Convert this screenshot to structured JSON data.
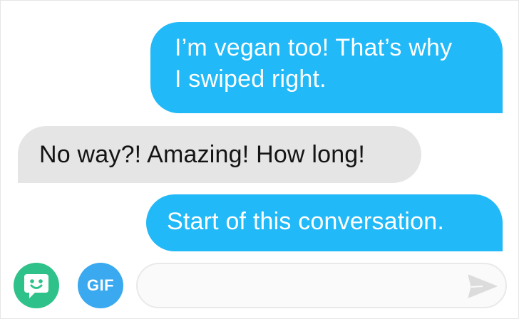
{
  "messages": [
    {
      "direction": "sent",
      "lines": [
        "I’m vegan too! That’s why",
        "I swiped right."
      ]
    },
    {
      "direction": "received",
      "text": "No way?! Amazing! How long!"
    },
    {
      "direction": "sent",
      "text": "Start of this conversation."
    }
  ],
  "composer": {
    "sticker_icon": "smiley-sticker-icon",
    "gif_label": "GIF",
    "input_value": "",
    "input_placeholder": "",
    "send_icon": "send-arrow-icon"
  },
  "colors": {
    "sent_bubble": "#21b9f7",
    "received_bubble": "#e5e5e5",
    "sticker_button": "#2ec28a",
    "gif_button": "#3aa9ef",
    "send_icon": "#dcdcdc"
  }
}
